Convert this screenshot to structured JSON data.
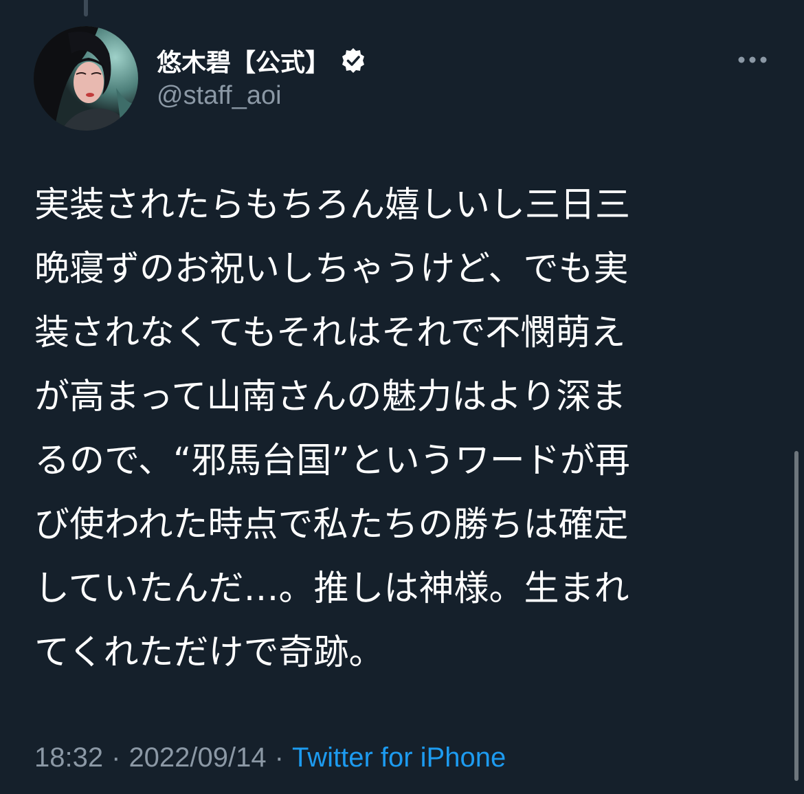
{
  "author": {
    "display_name": "悠木碧【公式】",
    "handle": "@staff_aoi",
    "verified_icon": "verified-badge-icon"
  },
  "tweet": {
    "lines": [
      "実装されたらもちろん嬉しいし三日三",
      "晩寝ずのお祝いしちゃうけど、でも実",
      "装されなくてもそれはそれで不憫萌え",
      "が高まって山南さんの魅力はより深ま",
      "るので、“邪馬台国”というワードが再",
      "び使われた時点で私たちの勝ちは確定",
      "していたんだ…。推しは神様。生まれ",
      "てくれただけで奇跡。"
    ]
  },
  "meta": {
    "time": "18:32",
    "separator": "·",
    "date": "2022/09/14",
    "source": "Twitter for iPhone"
  },
  "colors": {
    "background": "#15202b",
    "text": "#ffffff",
    "muted": "#8b98a5",
    "link": "#1d9bf0"
  }
}
